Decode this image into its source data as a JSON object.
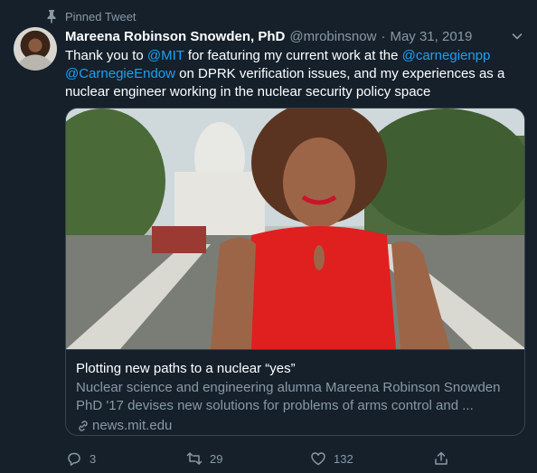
{
  "pinned": {
    "label": "Pinned Tweet"
  },
  "author": {
    "display_name": "Mareena Robinson Snowden, PhD",
    "handle": "@mrobinsnow",
    "separator": "·",
    "date": "May 31, 2019"
  },
  "tweet": {
    "text_part1": "Thank you to ",
    "mention_mit": "@MIT",
    "text_part2": " for featuring my current work at the ",
    "mention_carnegiepp": "@carnegienpp",
    "mention_carnegieendow": "@CarnegieEndow",
    "text_part3": " on DPRK verification issues, and my experiences as a nuclear engineer working in the nuclear security policy space"
  },
  "card": {
    "title": "Plotting new paths to a nuclear “yes”",
    "description": "Nuclear science and engineering alumna Mareena Robinson Snowden PhD '17 devises new solutions for problems of arms control and ...",
    "domain": "news.mit.edu"
  },
  "actions": {
    "reply_count": "3",
    "retweet_count": "29",
    "like_count": "132"
  },
  "icons": {
    "pin": "pin-icon",
    "caret": "chevron-down-icon",
    "link": "link-icon",
    "reply": "reply-icon",
    "retweet": "retweet-icon",
    "like": "heart-icon",
    "share": "share-icon"
  },
  "colors": {
    "background": "#15202b",
    "text_primary": "#ffffff",
    "text_secondary": "#8899a6",
    "link": "#1da1f2",
    "border": "#38444d"
  }
}
